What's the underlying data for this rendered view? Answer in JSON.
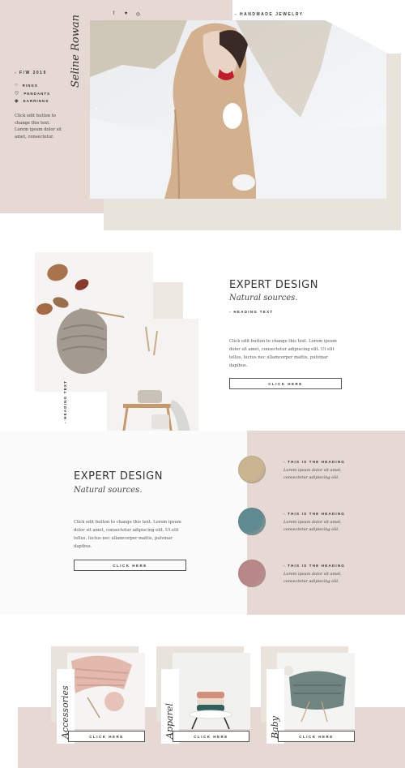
{
  "header": {
    "social": [
      {
        "icon": "facebook-icon",
        "glyph": "f"
      },
      {
        "icon": "twitter-icon",
        "glyph": "♥"
      },
      {
        "icon": "instagram-icon",
        "glyph": "◎"
      }
    ],
    "tagline": "- HANDMADE JEWELRY",
    "brand": "Seline Rowan"
  },
  "hero": {
    "season": "- F/W 2019",
    "categories": [
      {
        "label": "RINGS",
        "icon": "ring-icon"
      },
      {
        "label": "PENDANTS",
        "icon": "pendant-icon"
      },
      {
        "label": "EARRINGS",
        "icon": "earring-icon"
      }
    ],
    "text": "Click edit button to change this text. Lorem ipsum dolor sit amet, consectetur.",
    "prev_icon": "chevron-left-icon",
    "next_icon": "chevron-right-icon"
  },
  "section2": {
    "title": "EXPERT DESIGN",
    "subtitle": "Natural sources.",
    "small_heading": "- HEADING TEXT",
    "vertical_label": "- HEADING TEXT",
    "text": "Click edit button to change this text. Lorem ipsum dolor sit amet, consectetur adipiscing elit. Ut elit tellus, luctus nec ullamcorper mattis, pulvinar dapibus.",
    "button": "CLICK HERE"
  },
  "section3": {
    "title": "EXPERT DESIGN",
    "subtitle": "Natural sources.",
    "text": "Click edit button to change this text. Lorem ipsum dolor sit amet, consectetur adipiscing elit. Ut elit tellus, luctus nec ullamcorper mattis, pulvinar dapibus.",
    "button": "CLICK HERE",
    "features": [
      {
        "heading": "- THIS IS THE HEADING",
        "text": "Lorem ipsum dolor sit amet, consectetur adipiscing elit.",
        "color": "#c9b58f"
      },
      {
        "heading": "- THIS IS THE HEADING",
        "text": "Lorem ipsum dolor sit amet, consectetur adipiscing elit.",
        "color": "#5f8a90"
      },
      {
        "heading": "- THIS IS THE HEADING",
        "text": "Lorem ipsum dolor sit amet, consectetur adipiscing elit.",
        "color": "#b88787"
      }
    ]
  },
  "section4": {
    "cards": [
      {
        "label": "Accessories",
        "button": "CLICK HERE"
      },
      {
        "label": "Apparel",
        "button": "CLICK HERE"
      },
      {
        "label": "Baby",
        "button": "CLICK HERE"
      }
    ]
  },
  "colors": {
    "blush": "#e6d8d3",
    "beige": "#e8e4dc",
    "text": "#333333"
  }
}
